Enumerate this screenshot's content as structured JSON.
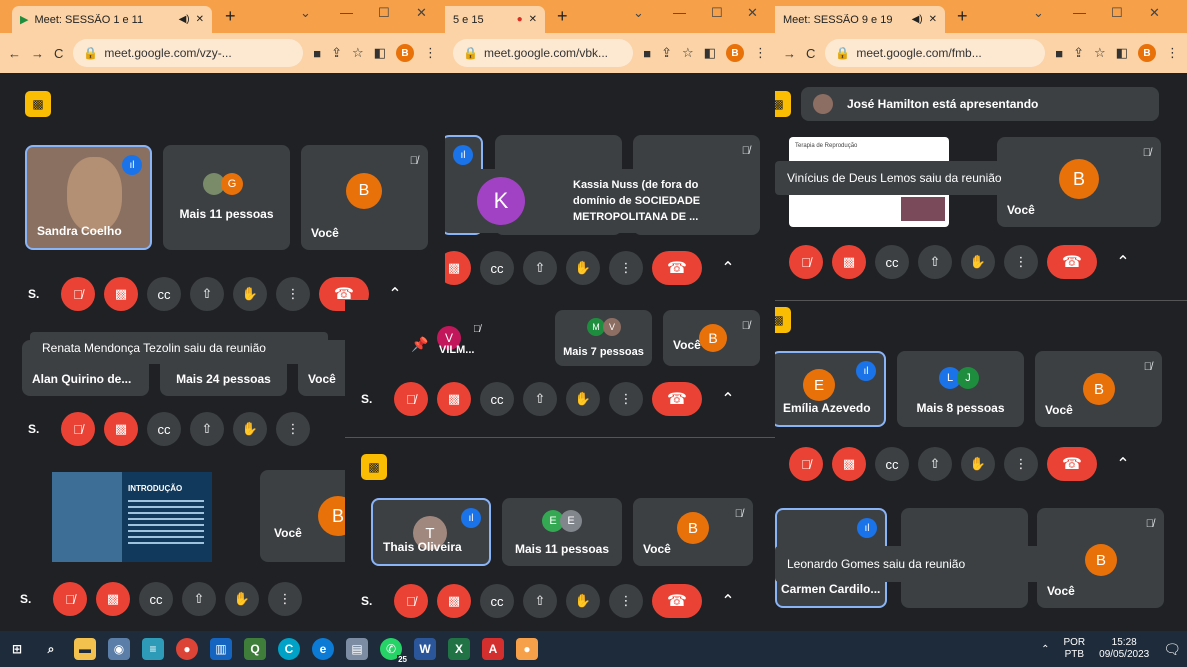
{
  "windows": {
    "w1": {
      "tab_title": "Meet: SESSÃO 1 e 11",
      "url": "meet.google.com/vzy-..."
    },
    "w2": {
      "tab_title": "5 e 15",
      "url": "meet.google.com/vbk..."
    },
    "w3": {
      "tab_title": "Meet: SESSÃO 9 e 19",
      "url": "meet.google.com/fmb..."
    }
  },
  "profile_initial": "B",
  "tiles": {
    "sandra": "Sandra Coelho",
    "more11": "Mais 11 pessoas",
    "you": "Você",
    "alan": "Alan Quirino de...",
    "more24": "Mais 24 pessoas",
    "kassia_name": "Kassia Nuss (de fora do domínio de SOCIEDADE METROPOLITANA DE ...",
    "vilm": "VILM...",
    "more7": "Mais 7 pessoas",
    "thais": "Thais Oliveira",
    "more11b": "Mais 11 pessoas",
    "emilia": "Emília Azevedo",
    "more8": "Mais 8 pessoas",
    "carmen": "Carmen Cardilo...",
    "presenting": "José Hamilton está apresentando",
    "slide_title": "INTRODUÇÃO",
    "slide_caption": "Terapia de Reprodução"
  },
  "initials": {
    "b": "B",
    "g": "G",
    "k": "K",
    "v": "V",
    "m": "M",
    "t": "T",
    "e": "E",
    "l": "L",
    "j": "J"
  },
  "toasts": {
    "renata": "Renata Mendonça Tezolin saiu da reunião",
    "vinicius": "Vinícius de Deus Lemos saiu da reunião",
    "leonardo": "Leonardo Gomes saiu da reunião"
  },
  "self_short": "S.",
  "taskbar": {
    "lang_top": "POR",
    "lang_bottom": "PTB",
    "time": "15:28",
    "date": "09/05/2023",
    "badge": "25"
  },
  "colors": {
    "accent": "#f6a04a",
    "orange_avatar": "#e8710a",
    "red": "#ea4335",
    "blue": "#1a73e8"
  }
}
